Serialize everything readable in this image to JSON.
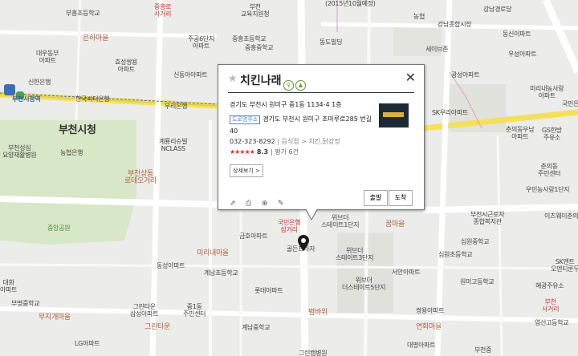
{
  "popup": {
    "title": "치킨나래",
    "star_glyph": "★",
    "badge_1": "♀",
    "badge_2": "▲",
    "close_glyph": "✕",
    "address_jibun": "경기도 부천시 원미구 중1동 1134-4 1층",
    "road_tag": "도로명주소",
    "address_road": "경기도 부천시 원미구 조마루로285 번길 40",
    "phone": "032-323-8292",
    "category": "| 음식점 > 치킨,닭강정",
    "stars": "★★★★★",
    "score": "8.3",
    "review_count": "| 평가 6건",
    "detail_label": "상세보기 >",
    "departure_label": "출발",
    "arrival_label": "도착",
    "tools": [
      {
        "name": "share-icon",
        "glyph": "⇗"
      },
      {
        "name": "print-icon",
        "glyph": "⎙"
      },
      {
        "name": "zoom-icon",
        "glyph": "⊕"
      },
      {
        "name": "edit-icon",
        "glyph": "✎"
      }
    ]
  },
  "labels": {
    "l1": "중흥로\n사거리",
    "l2": "부천\n교육지원청",
    "l3": "(2015년10월예정)",
    "l4": "강남경로당",
    "l5": "부흥초등학교",
    "l6": "농협",
    "l7": "강남종합시장",
    "l8": "동신이파트",
    "l9": "은하마을",
    "l10": "주공6단지\n아파트",
    "l11": "중흥초등학교",
    "l12": "중흥중학교",
    "l13": "동도빌딩",
    "l14": "세이브존",
    "l15": "우성아파트",
    "l16": "대우동부\n아파트",
    "l17": "효성쌍용\n아파트",
    "l18": "신동아아파트",
    "l19": "광성아파트",
    "l20": "미리내농사랑\n아파트",
    "l21": "신한은행",
    "l22": "한국씨티은행",
    "l23": "부천시청역",
    "l24": "우리은행",
    "l25": "SK우리아파트",
    "l26": "춘의동우남\n아파트",
    "l27": "국민은행",
    "l28": "부천시청",
    "l29": "계룡리슈빌\nNCLASS",
    "l30": "GS한방\n주유소",
    "l31": "부천성심\n요양재활병원",
    "l32": "농협은행",
    "l33": "춘의동\n주민센터",
    "l34": "부천상동\n로데오거리",
    "l35": "우민농사랑1단지",
    "l36": "중앙공원",
    "l37": "국민은행\n삼거리",
    "l38": "금호아파트",
    "l39": "위브더\n스테이트1단지",
    "l40": "꿈마을",
    "l41": "부천시근로자\n종합복지관",
    "l42": "이츠웨이춘의",
    "l43": "심원중학교",
    "l44": "심원초등학교",
    "l45": "골든프라자",
    "l46": "위브더\n스테이트3단지",
    "l47": "미리내마을",
    "l48": "동성아파트",
    "l49": "계남초등학교",
    "l50": "롯데아파트",
    "l51": "서안아파트",
    "l52": "위브더\n더스테이트5단지",
    "l53": "원미고등학교",
    "l54": "SK앤트\n오덴티룬두",
    "l55": "대화\n아파트",
    "l56": "부명중학교",
    "l57": "그린타운\n삼성아파트",
    "l58": "중1동\n주민센터",
    "l59": "쌍용아파트",
    "l60": "혜광주유소",
    "l61": "무지개마을",
    "l62": "그린타운",
    "l63": "계남중학교",
    "l64": "범바위",
    "l65": "연화마을",
    "l66": "부천\n사거리",
    "l67": "LG아파트",
    "l68": "그린캠병원",
    "l69": "대명아파트",
    "l70": "부천중",
    "l71": "영선고등학교"
  }
}
